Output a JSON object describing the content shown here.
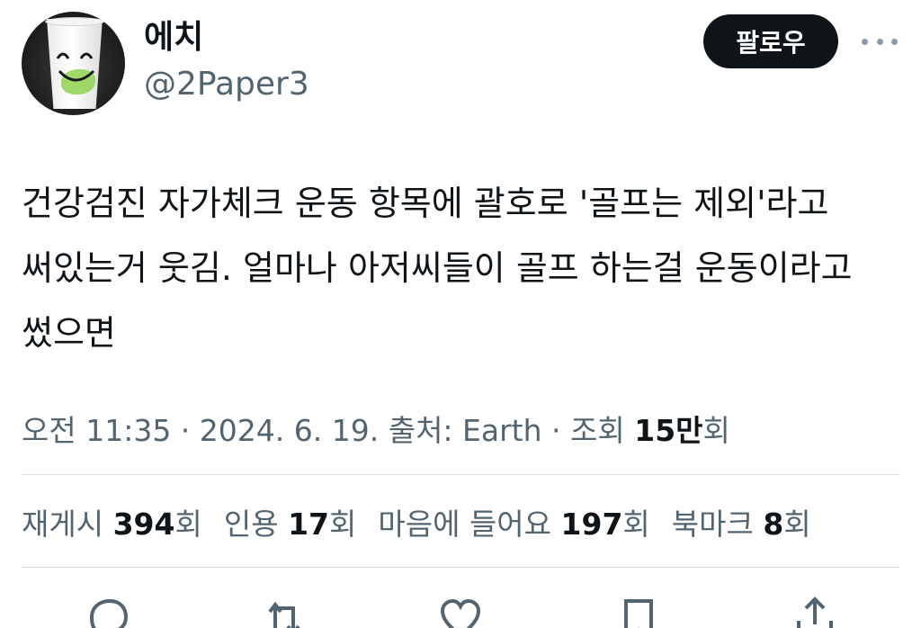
{
  "user": {
    "name": "에치",
    "handle": "@2Paper3",
    "follow_label": "팔로우"
  },
  "tweet": {
    "text": "건강검진 자가체크 운동 항목에 괄호로 '골프는 제외'라고 써있는거 웃김. 얼마나 아저씨들이 골프 하는걸 운동이라고 썼으면"
  },
  "meta": {
    "time": "오전 11:35",
    "sep1": " · ",
    "date": "2024. 6. 19.",
    "source_label": " 출처: ",
    "source": "Earth",
    "sep2": " · ",
    "views_label": "조회 ",
    "views_count": "15만",
    "views_unit": "회"
  },
  "stats": [
    {
      "label": "재게시 ",
      "count": "394",
      "unit": "회"
    },
    {
      "label": "인용 ",
      "count": "17",
      "unit": "회"
    },
    {
      "label": "마음에 들어요 ",
      "count": "197",
      "unit": "회"
    },
    {
      "label": "북마크 ",
      "count": "8",
      "unit": "회"
    }
  ],
  "actions": [
    "reply-icon",
    "retweet-icon",
    "like-icon",
    "bookmark-icon",
    "share-icon"
  ],
  "colors": {
    "text_primary": "#0f1419",
    "text_secondary": "#536471",
    "divider": "#d8dde1",
    "button_bg": "#0f1419"
  }
}
